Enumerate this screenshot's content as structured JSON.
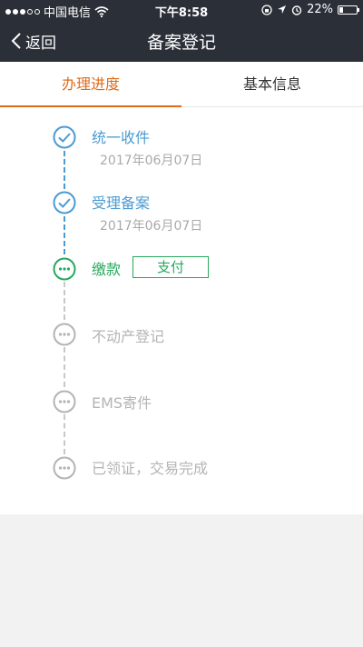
{
  "status_bar": {
    "carrier": "中国电信",
    "time": "下午8:58",
    "battery": "22%",
    "battery_level": 0.22
  },
  "nav": {
    "back_label": "返回",
    "title": "备案登记"
  },
  "tabs": [
    {
      "label": "办理进度",
      "active": true
    },
    {
      "label": "基本信息",
      "active": false
    }
  ],
  "steps": [
    {
      "title": "统一收件",
      "date": "2017年06月07日",
      "state": "done"
    },
    {
      "title": "受理备案",
      "date": "2017年06月07日",
      "state": "done"
    },
    {
      "title": "缴款",
      "state": "current",
      "action_label": "支付"
    },
    {
      "title": "不动产登记",
      "state": "pending"
    },
    {
      "title": "EMS寄件",
      "state": "pending"
    },
    {
      "title": "已领证，交易完成",
      "state": "pending"
    }
  ],
  "colors": {
    "navbar": "#2b3038",
    "accent_orange": "#e06a1a",
    "done_blue": "#4a9bd2",
    "current_green": "#27a85d",
    "pending_gray": "#b4b4b4"
  }
}
